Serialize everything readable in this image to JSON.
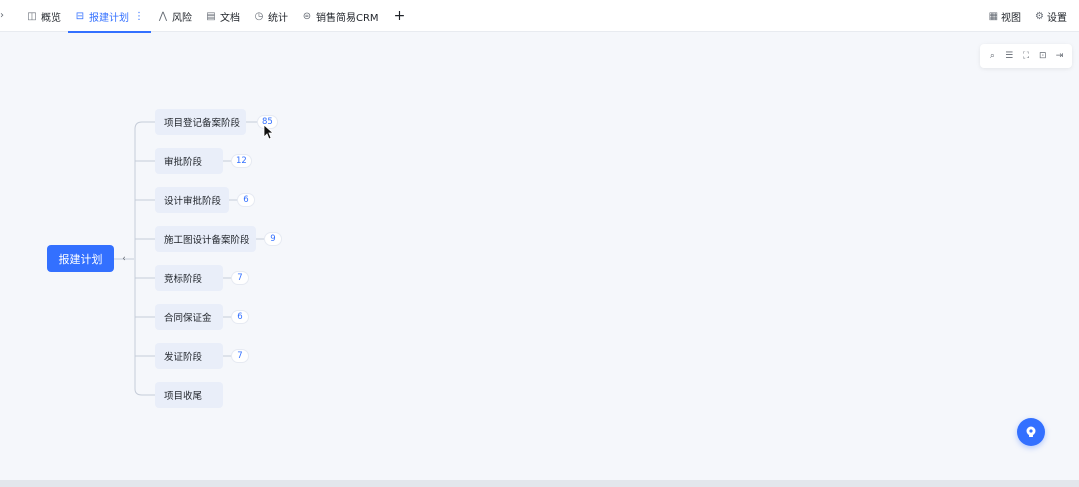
{
  "tabs": [
    {
      "label": "概览",
      "icon": "overview-icon",
      "glyph": "◫"
    },
    {
      "label": "报建计划",
      "icon": "plan-icon",
      "glyph": "⊟",
      "active": true,
      "more": "⋮"
    },
    {
      "label": "风险",
      "icon": "risk-icon",
      "glyph": "⋀"
    },
    {
      "label": "文档",
      "icon": "document-icon",
      "glyph": "▤"
    },
    {
      "label": "统计",
      "icon": "stats-icon",
      "glyph": "◷"
    },
    {
      "label": "销售简易CRM",
      "icon": "crm-icon",
      "glyph": "⊜"
    }
  ],
  "tab_add": "+",
  "top_right": {
    "view_label": "视图",
    "settings_label": "设置"
  },
  "toolbar": {
    "search": "⌕",
    "filter": "☰",
    "fullscreen": "⛶",
    "fit": "⊡",
    "export": "⇥"
  },
  "mindmap": {
    "root": "报建计划",
    "collapse": "‹",
    "nodes": [
      {
        "label": "项目登记备案阶段",
        "count": "85"
      },
      {
        "label": "审批阶段",
        "count": "12"
      },
      {
        "label": "设计审批阶段",
        "count": "6"
      },
      {
        "label": "施工图设计备案阶段",
        "count": "9"
      },
      {
        "label": "竞标阶段",
        "count": "7"
      },
      {
        "label": "合同保证金",
        "count": "6"
      },
      {
        "label": "发证阶段",
        "count": "7"
      },
      {
        "label": "项目收尾",
        "count": ""
      }
    ]
  },
  "colors": {
    "accent": "#3370ff",
    "node_bg": "#e9eef9",
    "canvas_bg": "#f5f7fb"
  }
}
